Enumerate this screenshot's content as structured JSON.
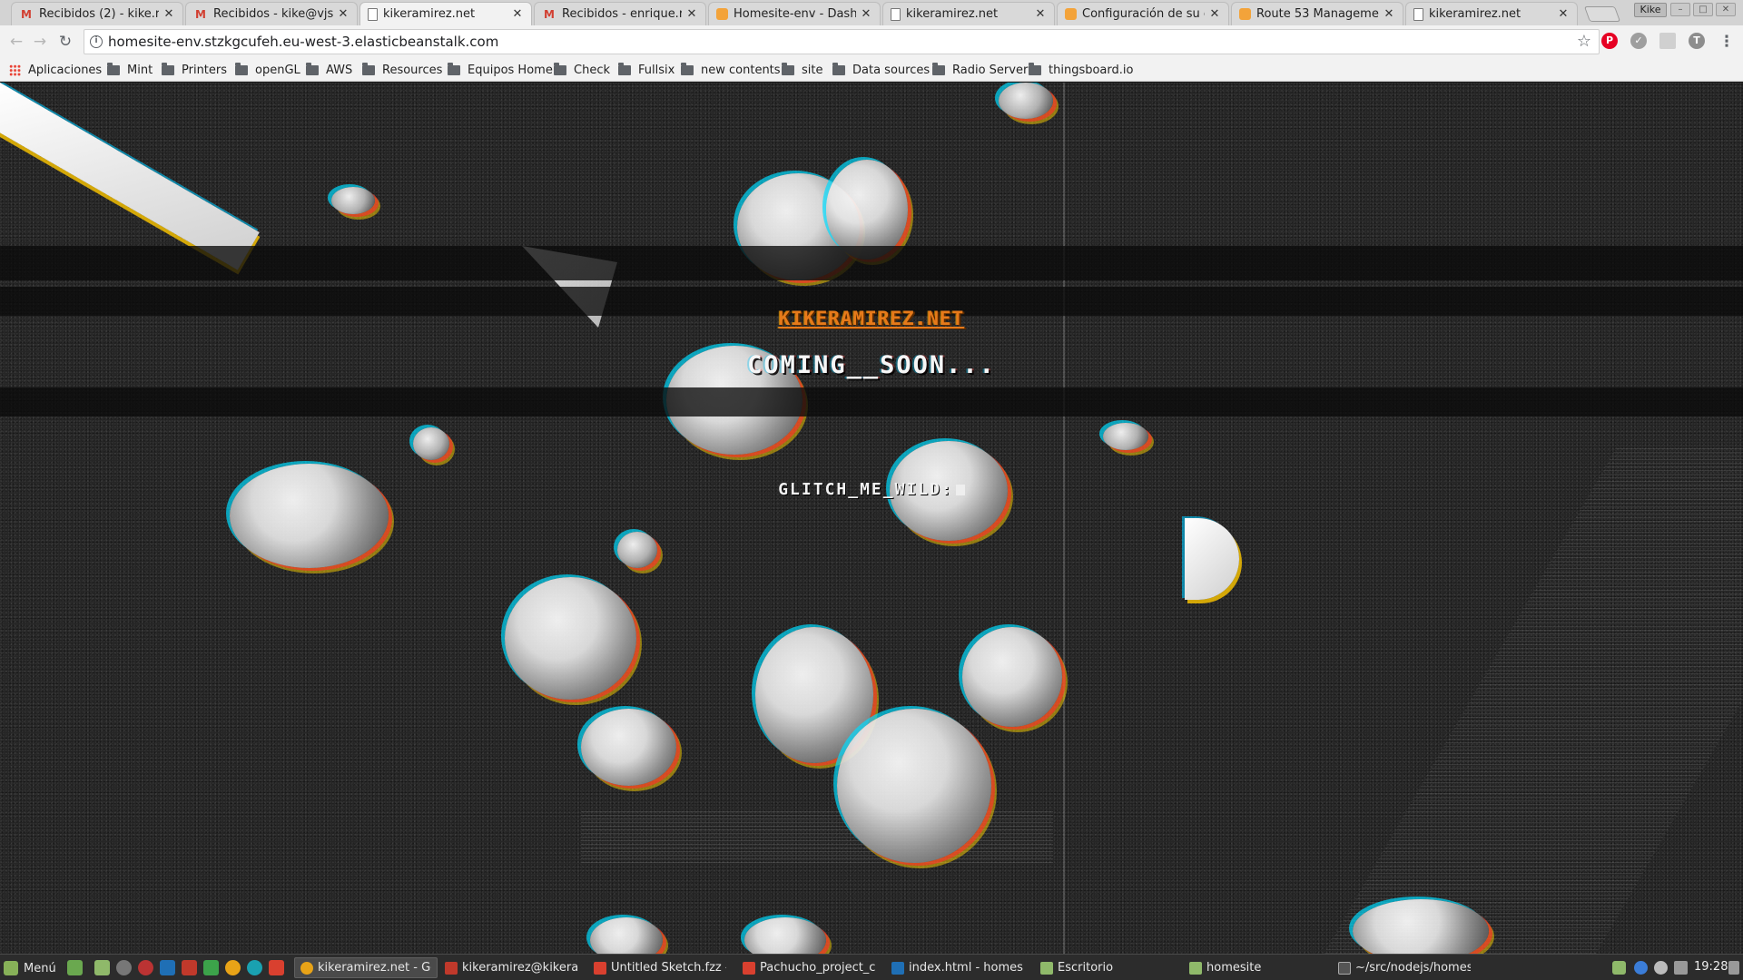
{
  "browser": {
    "tabs": [
      {
        "title": "Recibidos (2) - kike.ram",
        "favicon": "gmail-icon"
      },
      {
        "title": "Recibidos - kike@vjspai",
        "favicon": "gmail-icon"
      },
      {
        "title": "kikeramirez.net",
        "favicon": "page-icon"
      },
      {
        "title": "Recibidos - enrique.ram",
        "favicon": "gmail-icon"
      },
      {
        "title": "Homesite-env - Dashbo",
        "favicon": "aws-icon"
      },
      {
        "title": "kikeramirez.net",
        "favicon": "page-icon"
      },
      {
        "title": "Configuración de su em",
        "favicon": "aws-icon"
      },
      {
        "title": "Route 53 Management",
        "favicon": "aws-icon"
      },
      {
        "title": "kikeramirez.net",
        "favicon": "page-icon"
      }
    ],
    "active_tab_index": 2,
    "profile_name": "Kike",
    "url": "homesite-env.stzkgcufeh.eu-west-3.elasticbeanstalk.com",
    "bookmarks": [
      "Aplicaciones",
      "Mint",
      "Printers",
      "openGL",
      "AWS",
      "Resources",
      "Equipos Home",
      "Check",
      "Fullsix",
      "new contents",
      "site",
      "Data sources",
      "Radio Server",
      "thingsboard.io"
    ]
  },
  "page": {
    "site_title": "KIKERAMIREZ.NET",
    "headline": "COMING__SOON...",
    "prompt": "GLITCH_ME_WILD:",
    "title_color": "#e77a1a"
  },
  "taskbar": {
    "menu_label": "Menú",
    "tasks": [
      {
        "label": "kikeramirez.net - Go...",
        "icon": "chrome-icon"
      },
      {
        "label": "kikeramirez@kikera...",
        "icon": "terminal-icon"
      },
      {
        "label": "Untitled Sketch.fzz - ...",
        "icon": "fritzing-icon"
      },
      {
        "label": "Pachucho_project_c...",
        "icon": "fritzing-icon"
      },
      {
        "label": "index.html - homesit...",
        "icon": "vscode-icon"
      },
      {
        "label": "Escritorio",
        "icon": "folder-icon"
      },
      {
        "label": "homesite",
        "icon": "folder-icon"
      },
      {
        "label": "~/src/nodejs/homesi...",
        "icon": "terminal-icon"
      }
    ],
    "clock": "19:28"
  }
}
